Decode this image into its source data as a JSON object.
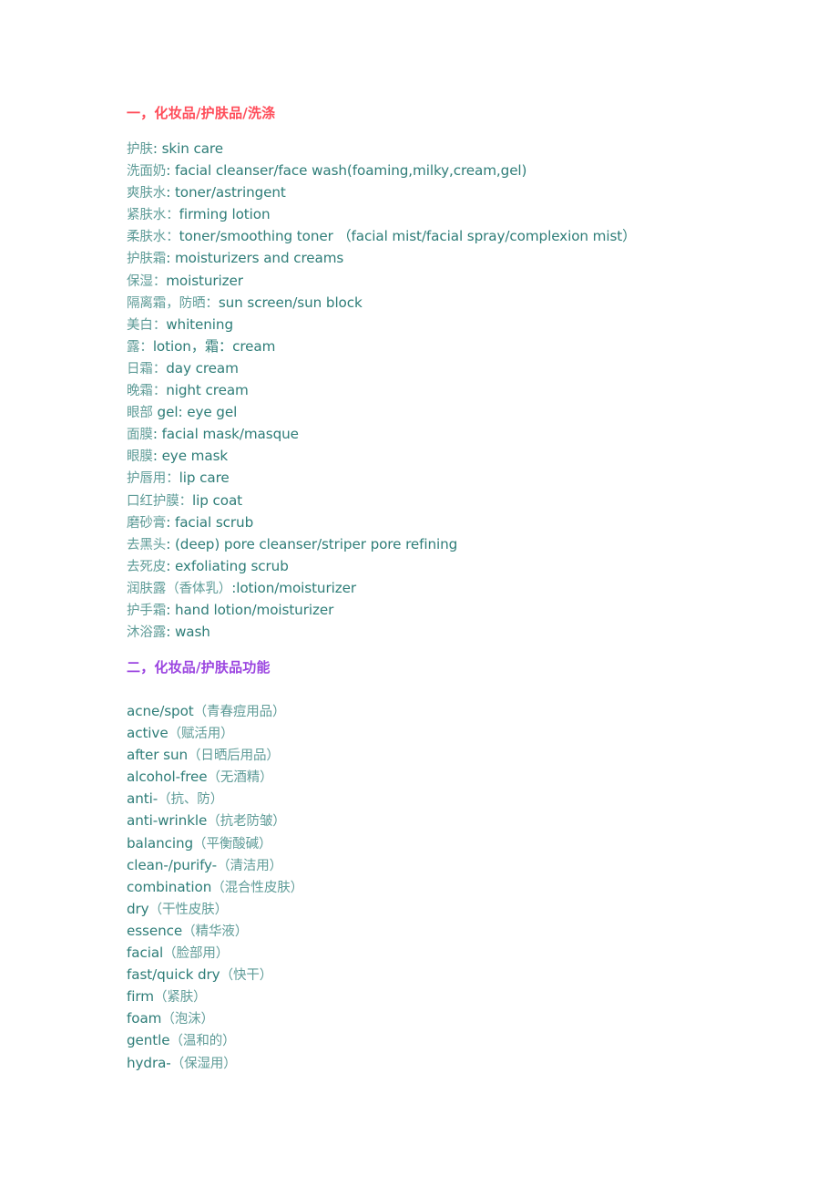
{
  "colors": {
    "section1_heading": "#ff4d5a",
    "section2_heading": "#9b45e0",
    "term_chinese": "#5f9c98",
    "term_english": "#2e7d78"
  },
  "sections": [
    {
      "heading": "一，化妆品/护肤品/洗涤",
      "items": [
        {
          "zh": "护肤",
          "sep": ": ",
          "en": "skin care"
        },
        {
          "zh": "洗面奶",
          "sep": ": ",
          "en": "facial cleanser/face wash(foaming,milky,cream,gel)"
        },
        {
          "zh": "爽肤水",
          "sep": ": ",
          "en": "toner/astringent"
        },
        {
          "zh": "紧肤水",
          "sep": "：",
          "en": "firming lotion"
        },
        {
          "zh": "柔肤水",
          "sep": "：",
          "en": "toner/smoothing toner （facial mist/facial spray/complexion mist）"
        },
        {
          "zh": "护肤霜",
          "sep": ": ",
          "en": "moisturizers and creams"
        },
        {
          "zh": "保湿",
          "sep": "：",
          "en": "moisturizer"
        },
        {
          "zh": "隔离霜，防晒",
          "sep": "：",
          "en": "sun screen/sun block"
        },
        {
          "zh": "美白",
          "sep": "：",
          "en": "whitening"
        },
        {
          "zh": "露",
          "sep": "：",
          "en": "lotion，霜：cream"
        },
        {
          "zh": "日霜",
          "sep": "：",
          "en": "day cream"
        },
        {
          "zh": "晚霜",
          "sep": "：",
          "en": "night cream"
        },
        {
          "zh": "眼部",
          "sep": " ",
          "en": "gel: eye gel"
        },
        {
          "zh": "面膜",
          "sep": ": ",
          "en": "facial mask/masque"
        },
        {
          "zh": "眼膜",
          "sep": ": ",
          "en": "eye mask"
        },
        {
          "zh": "护唇用",
          "sep": "：",
          "en": "lip care"
        },
        {
          "zh": "口红护膜",
          "sep": "：",
          "en": "lip coat"
        },
        {
          "zh": "磨砂膏",
          "sep": ": ",
          "en": "facial scrub"
        },
        {
          "zh": "去黑头",
          "sep": ": ",
          "en": "(deep) pore cleanser/striper pore refining"
        },
        {
          "zh": "去死皮",
          "sep": ": ",
          "en": "exfoliating scrub"
        },
        {
          "zh": "润肤露（香体乳）",
          "sep": ":",
          "en": "lotion/moisturizer"
        },
        {
          "zh": "护手霜",
          "sep": ": ",
          "en": "hand lotion/moisturizer"
        },
        {
          "zh": "沐浴露",
          "sep": ": ",
          "en": "wash"
        }
      ]
    },
    {
      "heading": "二，化妆品/护肤品功能",
      "items": [
        {
          "en": "acne/spot",
          "zh": "（青春痘用品）"
        },
        {
          "en": "active",
          "zh": "（赋活用）"
        },
        {
          "en": "after sun",
          "zh": "（日晒后用品）"
        },
        {
          "en": "alcohol-free",
          "zh": "（无酒精）"
        },
        {
          "en": "anti-",
          "zh": "（抗、防）"
        },
        {
          "en": "anti-wrinkle",
          "zh": "（抗老防皱）"
        },
        {
          "en": "balancing",
          "zh": "（平衡酸碱）"
        },
        {
          "en": "clean-/purify-",
          "zh": "（清洁用）"
        },
        {
          "en": "combination",
          "zh": "（混合性皮肤）"
        },
        {
          "en": "dry",
          "zh": "（干性皮肤）"
        },
        {
          "en": "essence",
          "zh": "（精华液）"
        },
        {
          "en": "facial",
          "zh": "（脸部用）"
        },
        {
          "en": "fast/quick dry",
          "zh": "（快干）"
        },
        {
          "en": "firm",
          "zh": "（紧肤）"
        },
        {
          "en": "foam",
          "zh": "（泡沫）"
        },
        {
          "en": "gentle",
          "zh": "（温和的）"
        },
        {
          "en": "hydra-",
          "zh": "（保湿用）"
        }
      ]
    }
  ]
}
